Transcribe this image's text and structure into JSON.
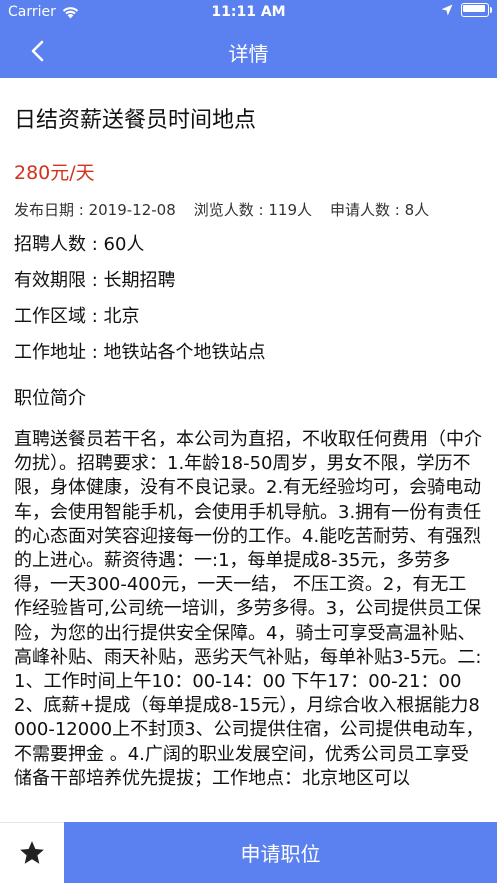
{
  "status_bar": {
    "carrier": "Carrier",
    "time": "11:11 AM"
  },
  "nav": {
    "title": "详情",
    "back_icon": "chevron-left-icon"
  },
  "job": {
    "title": "日结资薪送餐员时间地点",
    "salary": "280元/天",
    "publish_date": "发布日期 : 2019-12-08",
    "views": "浏览人数 : 119人",
    "applicants": "申请人数 : 8人",
    "headcount": "招聘人数 : 60人",
    "validity": "有效期限 : 长期招聘",
    "area": "工作区域 : 北京",
    "address": "工作地址 : 地铁站各个地铁站点"
  },
  "description": {
    "title": "职位简介",
    "text": "直聘送餐员若干名，本公司为直招，不收取任何费用（中介勿扰）。招聘要求：1.年龄18-50周岁，男女不限，学历不限，身体健康，没有不良记录。2.有无经验均可，会骑电动车，会使用智能手机，会使用手机导航。3.拥有一份有责任的心态面对笑容迎接每一份的工作。4.能吃苦耐劳、有强烈的上进心。薪资待遇：一:1，每单提成8-35元，多劳多得，一天300-400元，一天一结， 不压工资。2，有无工作经验皆可,公司统一培训，多劳多得。3，公司提供员工保险，为您的出行提供安全保障。4，骑士可享受高温补贴、高峰补贴、雨天补贴，恶劣天气补贴，每单补贴3-5元。二:1、工作时间上午10：00-14：00 下午17：00-21：002、底薪+提成（每单提成8-15元），月综合收入根据能力8000-12000上不封顶3、公司提供住宿，公司提供电动车，不需要押金 。4.广阔的职业发展空间，优秀公司员工享受储备干部培养优先提拔；工作地点：北京地区可以"
  },
  "footer": {
    "favorite_icon": "star-icon",
    "apply_label": "申请职位"
  },
  "colors": {
    "primary": "#5b80ef",
    "salary": "#d0331f"
  }
}
